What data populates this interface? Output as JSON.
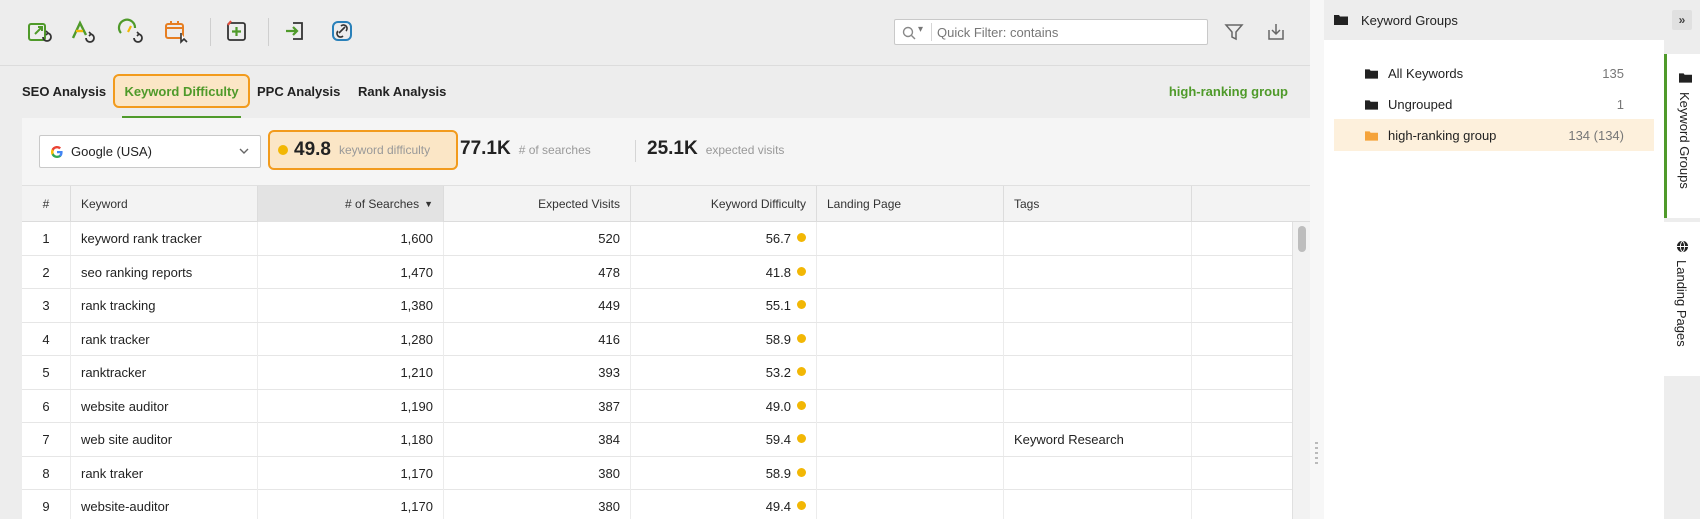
{
  "toolbar": {
    "icons": [
      "update-rankings-icon",
      "update-keyword-difficulty-icon",
      "update-searches-icon",
      "update-schedule-icon",
      "add-keywords-icon",
      "import-keywords-icon",
      "link-icon"
    ],
    "quick_filter_placeholder": "Quick Filter: contains"
  },
  "tabs": {
    "seo": "SEO Analysis",
    "kd": "Keyword Difficulty",
    "ppc": "PPC Analysis",
    "rank": "Rank Analysis",
    "group_label": "high-ranking group"
  },
  "stats": {
    "engine": "Google (USA)",
    "kd_value": "49.8",
    "kd_label": "keyword difficulty",
    "searches_value": "77.1K",
    "searches_label": "# of searches",
    "visits_value": "25.1K",
    "visits_label": "expected visits"
  },
  "table": {
    "headers": {
      "idx": "#",
      "keyword": "Keyword",
      "searches": "# of Searches",
      "visits": "Expected Visits",
      "kd": "Keyword Difficulty",
      "landing": "Landing Page",
      "tags": "Tags"
    },
    "rows": [
      {
        "idx": "1",
        "keyword": "keyword rank tracker",
        "searches": "1,600",
        "visits": "520",
        "kd": "56.7",
        "landing": "",
        "tags": ""
      },
      {
        "idx": "2",
        "keyword": "seo ranking reports",
        "searches": "1,470",
        "visits": "478",
        "kd": "41.8",
        "landing": "",
        "tags": ""
      },
      {
        "idx": "3",
        "keyword": "rank tracking",
        "searches": "1,380",
        "visits": "449",
        "kd": "55.1",
        "landing": "",
        "tags": ""
      },
      {
        "idx": "4",
        "keyword": "rank tracker",
        "searches": "1,280",
        "visits": "416",
        "kd": "58.9",
        "landing": "",
        "tags": ""
      },
      {
        "idx": "5",
        "keyword": "ranktracker",
        "searches": "1,210",
        "visits": "393",
        "kd": "53.2",
        "landing": "",
        "tags": ""
      },
      {
        "idx": "6",
        "keyword": "website auditor",
        "searches": "1,190",
        "visits": "387",
        "kd": "49.0",
        "landing": "",
        "tags": ""
      },
      {
        "idx": "7",
        "keyword": "web site auditor",
        "searches": "1,180",
        "visits": "384",
        "kd": "59.4",
        "landing": "",
        "tags": "Keyword Research"
      },
      {
        "idx": "8",
        "keyword": "rank traker",
        "searches": "1,170",
        "visits": "380",
        "kd": "58.9",
        "landing": "",
        "tags": ""
      },
      {
        "idx": "9",
        "keyword": "website-auditor",
        "searches": "1,170",
        "visits": "380",
        "kd": "49.4",
        "landing": "",
        "tags": ""
      }
    ]
  },
  "right_panel": {
    "title": "Keyword Groups",
    "groups": [
      {
        "name": "All Keywords",
        "count": "135"
      },
      {
        "name": "Ungrouped",
        "count": "1"
      },
      {
        "name": "high-ranking group",
        "count": "134 (134)"
      }
    ]
  },
  "side_tabs": {
    "keyword_groups": "Keyword Groups",
    "landing_pages": "Landing Pages"
  },
  "colors": {
    "accent_green": "#4f9a2a",
    "highlight_orange": "#f29b1d",
    "difficulty_dot": "#f2b705",
    "group_folder_orange": "#f5a33a"
  }
}
